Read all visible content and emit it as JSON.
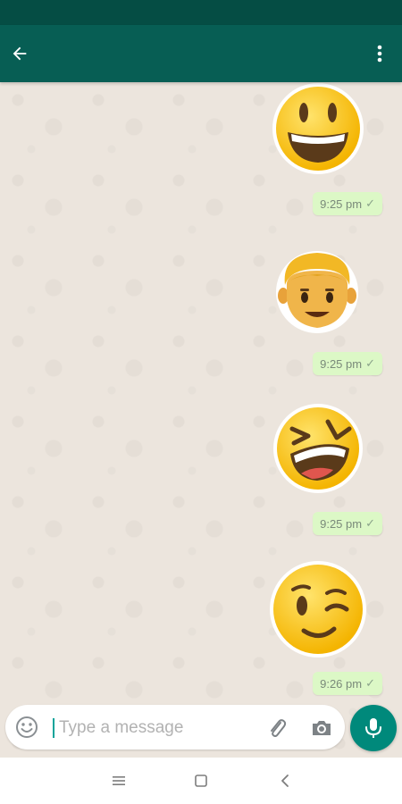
{
  "colors": {
    "appbar": "#075e54",
    "statusbar": "#054d44",
    "bubble": "#dcf8c6",
    "accent": "#00897b",
    "chat_bg": "#ece5dd"
  },
  "header": {
    "back_icon": "arrow-left-icon",
    "menu_icon": "more-vert-icon"
  },
  "messages": [
    {
      "sticker": "grinning-face",
      "time": "9:25 pm",
      "status": "✓"
    },
    {
      "sticker": "boy-face",
      "time": "9:25 pm",
      "status": "✓"
    },
    {
      "sticker": "laughing-squint-face",
      "time": "9:25 pm",
      "status": "✓"
    },
    {
      "sticker": "winking-face",
      "time": "9:26 pm",
      "status": "✓"
    }
  ],
  "composer": {
    "placeholder": "Type a message",
    "emoji_icon": "emoji-icon",
    "attach_icon": "paperclip-icon",
    "camera_icon": "camera-icon",
    "mic_icon": "microphone-icon"
  },
  "navbar": {
    "icons": [
      "menu-icon",
      "home-square-icon",
      "back-chevron-icon"
    ]
  }
}
